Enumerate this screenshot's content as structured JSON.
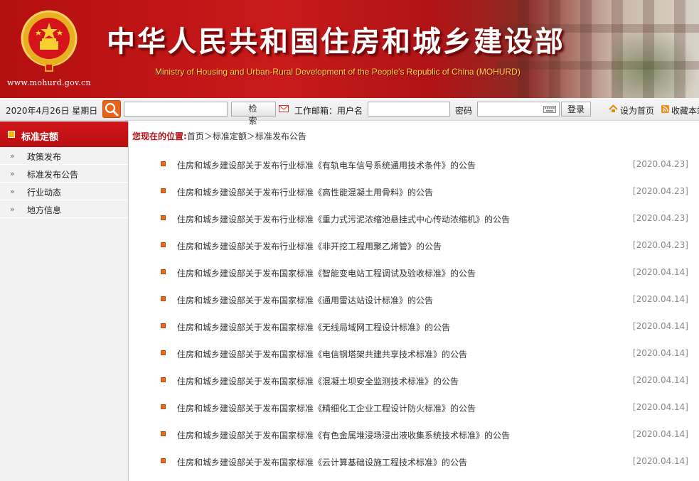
{
  "header": {
    "title": "中华人民共和国住房和城乡建设部",
    "subtitle": "Ministry of Housing and Urban-Rural Development of the People's Republic of China (MOHURD)",
    "url": "www.mohurd.gov.cn",
    "colors": {
      "banner_red": "#c81a1b",
      "subtitle_gold": "#ffd54a"
    }
  },
  "toolbar": {
    "date": "2020年4月26日 星期日",
    "search_icon": "search-icon",
    "search_button": "检 索",
    "mail_label": "工作邮箱：用户名",
    "password_label": "密码",
    "login_button": "登录",
    "set_home": "设为首页",
    "favorite": "收藏本站"
  },
  "sidebar": {
    "title": "标准定额",
    "items": [
      {
        "label": "政策发布"
      },
      {
        "label": "标准发布公告"
      },
      {
        "label": "行业动态"
      },
      {
        "label": "地方信息"
      }
    ]
  },
  "breadcrumb": {
    "prefix": "您现在的位置:",
    "path": "首页＞标准定额＞标准发布公告"
  },
  "news": [
    {
      "title": "住房和城乡建设部关于发布行业标准《有轨电车信号系统通用技术条件》的公告",
      "date": "[2020.04.23]"
    },
    {
      "title": "住房和城乡建设部关于发布行业标准《高性能混凝土用骨料》的公告",
      "date": "[2020.04.23]"
    },
    {
      "title": "住房和城乡建设部关于发布行业标准《重力式污泥浓缩池悬挂式中心传动浓缩机》的公告",
      "date": "[2020.04.23]"
    },
    {
      "title": "住房和城乡建设部关于发布行业标准《非开挖工程用聚乙烯管》的公告",
      "date": "[2020.04.23]"
    },
    {
      "title": "住房和城乡建设部关于发布国家标准《智能变电站工程调试及验收标准》的公告",
      "date": "[2020.04.14]"
    },
    {
      "title": "住房和城乡建设部关于发布国家标准《通用雷达站设计标准》的公告",
      "date": "[2020.04.14]"
    },
    {
      "title": "住房和城乡建设部关于发布国家标准《无线局域网工程设计标准》的公告",
      "date": "[2020.04.14]"
    },
    {
      "title": "住房和城乡建设部关于发布国家标准《电信钢塔架共建共享技术标准》的公告",
      "date": "[2020.04.14]"
    },
    {
      "title": "住房和城乡建设部关于发布国家标准《混凝土坝安全监测技术标准》的公告",
      "date": "[2020.04.14]"
    },
    {
      "title": "住房和城乡建设部关于发布国家标准《精细化工企业工程设计防火标准》的公告",
      "date": "[2020.04.14]"
    },
    {
      "title": "住房和城乡建设部关于发布国家标准《有色金属堆浸场浸出液收集系统技术标准》的公告",
      "date": "[2020.04.14]"
    },
    {
      "title": "住房和城乡建设部关于发布国家标准《云计算基础设施工程技术标准》的公告",
      "date": "[2020.04.14]"
    }
  ]
}
